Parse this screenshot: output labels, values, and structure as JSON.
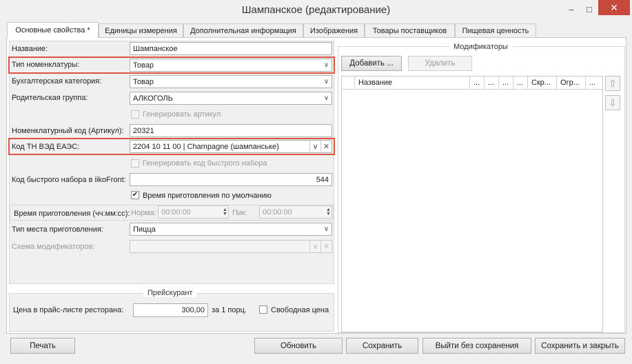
{
  "window": {
    "title": "Шампанское (редактирование)",
    "minimize": "–",
    "maximize": "□",
    "close": "✕"
  },
  "tabs": [
    {
      "label": "Основные свойства *"
    },
    {
      "label": "Единицы измерения"
    },
    {
      "label": "Дополнительная информация"
    },
    {
      "label": "Изображения"
    },
    {
      "label": "Товары поставщиков"
    },
    {
      "label": "Пищевая ценность"
    }
  ],
  "form": {
    "name": {
      "label": "Название:",
      "value": "Шампанское"
    },
    "nomenclature_type": {
      "label": "Тип номенклатуры:",
      "value": "Товар"
    },
    "accounting_category": {
      "label": "Бухгалтерская категория:",
      "value": "Товар"
    },
    "parent_group": {
      "label": "Родительская группа:",
      "value": "АЛКОГОЛЬ"
    },
    "generate_article": {
      "label": "Генерировать артикул"
    },
    "article_code": {
      "label": "Номенклатурный код (Артикул):",
      "value": "20321"
    },
    "tn_ved": {
      "label": "Код ТН ВЭД ЕАЭС:",
      "value": "2204 10 11 00 | Champagne (шампанське)"
    },
    "generate_quick_code": {
      "label": "Генерировать код быстрого набора"
    },
    "quick_code": {
      "label": "Код быстрого набора в iikoFront:",
      "value": "544"
    },
    "default_cook_time": {
      "label": "Время приготовления по умолчанию",
      "checked": "✔"
    },
    "cook_time": {
      "label": "Время приготовления (чч:мм:сс):",
      "norm_label": "Норма:",
      "norm_value": "00:00:00",
      "peak_label": "Пик:",
      "peak_value": "00:00:00"
    },
    "cook_place": {
      "label": "Тип места приготовления:",
      "value": "Пицца"
    },
    "modifier_scheme": {
      "label": "Схема модификаторов:",
      "value": ""
    }
  },
  "pricelist": {
    "title": "Прейскурант",
    "price_label": "Цена в прайс-листе ресторана:",
    "price_value": "300,00",
    "per_portion": "за 1 порц.",
    "free_price_label": "Свободная цена"
  },
  "modifiers": {
    "title": "Модификаторы",
    "add_button": "Добавить ...",
    "delete_button": "Удалить",
    "columns": [
      "Название",
      "...",
      "...",
      "...",
      "...",
      "Скр...",
      "Огр...",
      "..."
    ]
  },
  "footer": {
    "print": "Печать",
    "refresh": "Обновить",
    "save": "Сохранить",
    "exit_no_save": "Выйти без сохранения",
    "save_close": "Сохранить и закрыть"
  },
  "icons": {
    "dropdown": "chevron-down-icon",
    "clear": "close-icon",
    "up": "arrow-up-icon",
    "down": "arrow-down-icon"
  }
}
